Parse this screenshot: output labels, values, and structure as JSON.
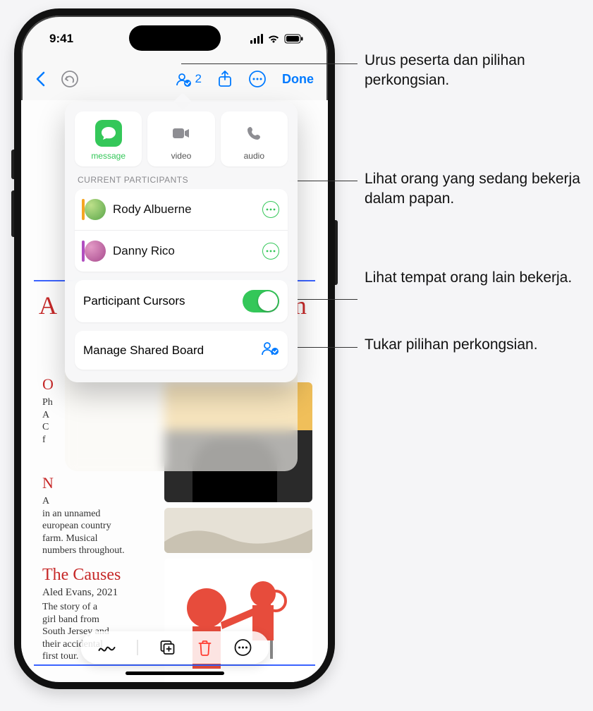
{
  "status": {
    "time": "9:41"
  },
  "toolbar": {
    "participant_count": "2",
    "done_label": "Done"
  },
  "popover": {
    "contact": {
      "message": "message",
      "video": "video",
      "audio": "audio"
    },
    "participants_header": "CURRENT PARTICIPANTS",
    "participants": [
      {
        "name": "Rody Albuerne",
        "color": "#f5a623",
        "avatar_bg": "#7ac06e"
      },
      {
        "name": "Danny Rico",
        "color": "#b14ec0",
        "avatar_bg": "#c66aa0"
      }
    ],
    "cursors_label": "Participant Cursors",
    "cursors_on": true,
    "manage_label": "Manage Shared Board"
  },
  "board": {
    "headline_left": "A",
    "headline_right": "eam",
    "note1_title": "O",
    "note1_body": "Ph\nA\nC\nf",
    "note2_title": "N",
    "note2_body": "A\nin an unnamed\neuropean country\nfarm. Musical\nnumbers throughout.",
    "note3_title": "The Causes",
    "note3_sub": "Aled Evans, 2021",
    "note3_body": "The story of a\ngirl band from\nSouth Jersey and\ntheir accidental\nfirst tour."
  },
  "callouts": {
    "c1": "Urus peserta dan pilihan perkongsian.",
    "c2": "Lihat orang yang sedang bekerja dalam papan.",
    "c3": "Lihat tempat orang lain bekerja.",
    "c4": "Tukar pilihan perkongsian."
  }
}
